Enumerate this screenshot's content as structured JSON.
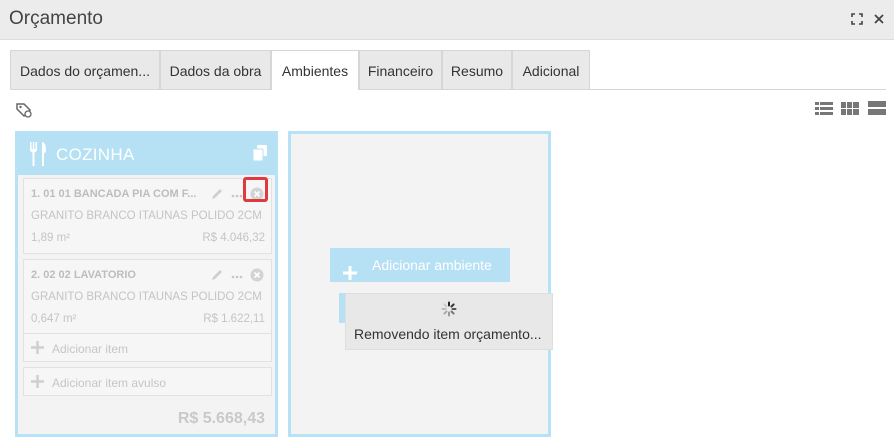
{
  "window": {
    "title": "Orçamento"
  },
  "tabs": [
    {
      "label": "Dados do orçamen..."
    },
    {
      "label": "Dados da obra"
    },
    {
      "label": "Ambientes"
    },
    {
      "label": "Financeiro"
    },
    {
      "label": "Resumo"
    },
    {
      "label": "Adicional"
    }
  ],
  "active_tab": "Ambientes",
  "environment": {
    "name": "COZINHA",
    "items": [
      {
        "code": "1. 01 01 BANCADA PIA COM F...",
        "material": "GRANITO BRANCO ITAUNAS POLIDO 2CM",
        "area": "1,89 m²",
        "price": "R$ 4.046,32"
      },
      {
        "code": "2. 02 02 LAVATORIO",
        "material": "GRANITO BRANCO ITAUNAS POLIDO 2CM",
        "area": "0,647 m²",
        "price": "R$ 1.622,11"
      }
    ],
    "add_item_label": "Adicionar item",
    "add_loose_item_label": "Adicionar item avulso",
    "total": "R$ 5.668,43"
  },
  "add_environment": {
    "label": "Adicionar ambiente"
  },
  "loading": {
    "message": "Removendo item orçamento..."
  },
  "colors": {
    "accent": "#b6e0f4",
    "highlight": "#e0393e"
  }
}
